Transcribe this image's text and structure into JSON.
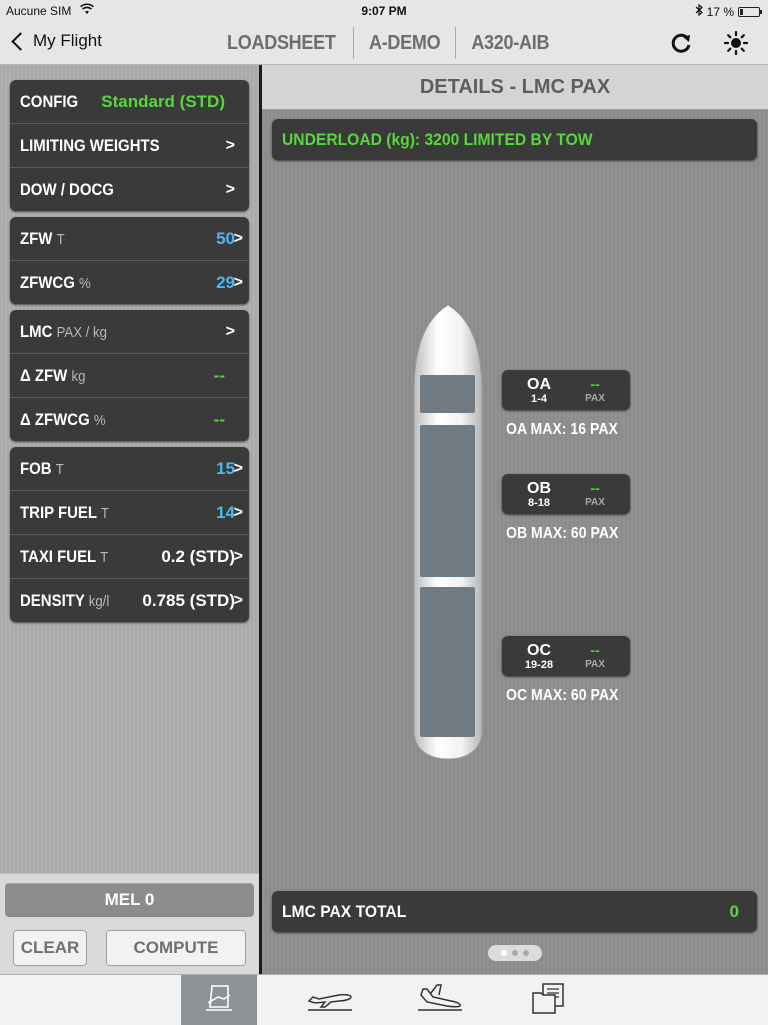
{
  "status": {
    "carrier": "Aucune SIM",
    "time": "9:07 PM",
    "battery": "17 %",
    "battery_level": 0.17
  },
  "nav": {
    "back_label": "My Flight",
    "tabs": [
      "LOADSHEET",
      "A-DEMO",
      "A320-AIB"
    ],
    "icons": [
      "refresh-icon",
      "brightness-icon"
    ]
  },
  "left": {
    "config": {
      "label": "CONFIG",
      "value": "Standard (STD)"
    },
    "limiting_weights": {
      "label": "LIMITING WEIGHTS",
      "chevron": ">"
    },
    "dow_docg": {
      "label": "DOW / DOCG",
      "chevron": ">"
    },
    "zfw": {
      "label": "ZFW",
      "unit": "T",
      "value": "50",
      "chevron": ">"
    },
    "zfwcg": {
      "label": "ZFWCG",
      "unit": "%",
      "value": "29",
      "chevron": ">"
    },
    "lmc": {
      "label": "LMC",
      "unit": "PAX / kg",
      "chevron": ">"
    },
    "delta_zfw": {
      "label": "Δ ZFW",
      "unit": "kg",
      "value": "--"
    },
    "delta_zfwcg": {
      "label": "Δ ZFWCG",
      "unit": "%",
      "value": "--"
    },
    "fob": {
      "label": "FOB",
      "unit": "T",
      "value": "15",
      "chevron": ">"
    },
    "trip_fuel": {
      "label": "TRIP FUEL",
      "unit": "T",
      "value": "14",
      "chevron": ">"
    },
    "taxi_fuel": {
      "label": "TAXI FUEL",
      "unit": "T",
      "value": "0.2 (STD)",
      "chevron": ">"
    },
    "density": {
      "label": "DENSITY",
      "unit": "kg/l",
      "value": "0.785 (STD)",
      "chevron": ">"
    },
    "mel_label": "MEL 0",
    "clear_label": "CLEAR",
    "compute_label": "COMPUTE"
  },
  "right": {
    "header": "DETAILS - LMC PAX",
    "underload": "UNDERLOAD (kg): 3200 LIMITED BY TOW",
    "zones": [
      {
        "name": "OA",
        "rows": "1-4",
        "value": "--",
        "unit": "PAX",
        "max": "OA MAX: 16 PAX"
      },
      {
        "name": "OB",
        "rows": "8-18",
        "value": "--",
        "unit": "PAX",
        "max": "OB MAX: 60 PAX"
      },
      {
        "name": "OC",
        "rows": "19-28",
        "value": "--",
        "unit": "PAX",
        "max": "OC MAX: 60 PAX"
      }
    ],
    "total_label": "LMC PAX TOTAL",
    "total_value": "0",
    "page_count": 3,
    "active_page": 1
  },
  "tabbar": {
    "items": [
      "loadsheet-doc-icon",
      "takeoff-plane-icon",
      "landing-plane-icon",
      "documents-icon"
    ],
    "selected": 0
  },
  "colors": {
    "accent_green": "#58d63c",
    "value_blue": "#4db8f0",
    "card_bg": "#3a3a3a"
  }
}
